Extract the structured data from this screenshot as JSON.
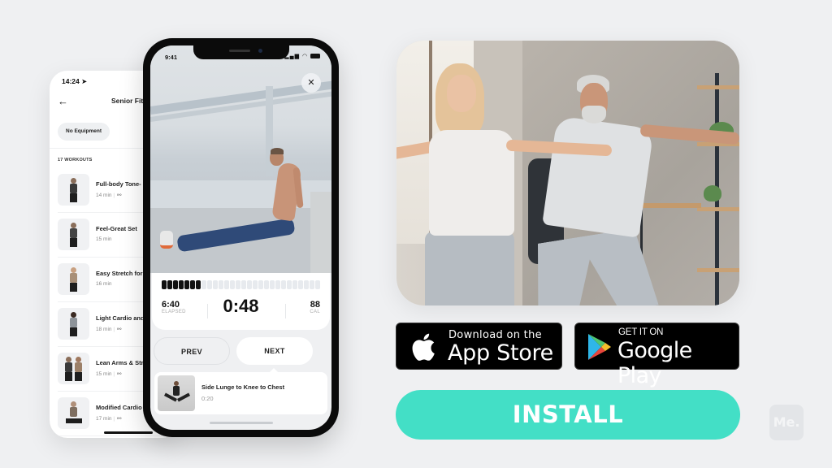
{
  "list_screen": {
    "status_time": "14:24",
    "status_location_icon": "location-arrow-icon",
    "back_icon": "arrow-left-icon",
    "title": "Senior Fit",
    "filter_chip": "No Equipment",
    "workout_count": "17 WORKOUTS",
    "workouts": [
      {
        "name": "Full-body Tone-",
        "duration": "14 min",
        "equipment_icon": "dumbbell-icon",
        "meta_sep": "|"
      },
      {
        "name": "Feel-Great Set",
        "duration": "15 min",
        "equipment_icon": "",
        "meta_sep": ""
      },
      {
        "name": "Easy Stretch for",
        "duration": "16 min",
        "equipment_icon": "",
        "meta_sep": ""
      },
      {
        "name": "Light Cardio and",
        "duration": "18 min",
        "equipment_icon": "dumbbell-icon",
        "meta_sep": "|"
      },
      {
        "name": "Lean Arms & Stre",
        "duration": "15 min",
        "equipment_icon": "dumbbell-icon",
        "meta_sep": "|"
      },
      {
        "name": "Modified Cardio",
        "duration": "17 min",
        "equipment_icon": "dumbbell-icon",
        "meta_sep": "|"
      }
    ]
  },
  "player_screen": {
    "status_time": "9:41",
    "status_icons": "signal wifi battery",
    "close_label": "✕",
    "progress": {
      "completed_segments": 7,
      "total_segments": 28
    },
    "elapsed_value": "6:40",
    "elapsed_label": "ELAPSED",
    "timer": "0:48",
    "cal_value": "88",
    "cal_label": "CAL",
    "prev_label": "PREV",
    "next_label": "NEXT",
    "next_exercise": {
      "title": "Side Lunge to Knee to Chest",
      "duration": "0:20"
    }
  },
  "store_badges": {
    "apple": {
      "small": "Download on the",
      "big": "App Store",
      "icon": "apple-icon"
    },
    "google": {
      "small": "GET IT ON",
      "big": "Google Play",
      "icon": "google-play-icon"
    }
  },
  "install_label": "INSTALL",
  "brand_logo": "Me.",
  "colors": {
    "background": "#eff0f2",
    "install_accent": "#43dfc6",
    "badge_bg": "#000000"
  }
}
